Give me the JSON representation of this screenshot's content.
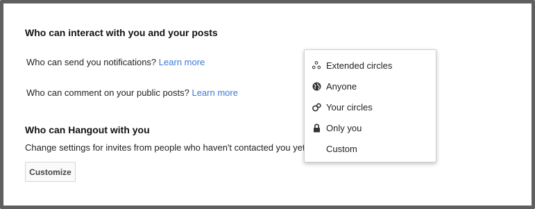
{
  "interact": {
    "title": "Who can interact with you and your posts",
    "notifications": {
      "text": "Who can send you notifications?",
      "link": "Learn more"
    },
    "comments": {
      "text": "Who can comment on your public posts?",
      "link": "Learn more"
    }
  },
  "hangout": {
    "title": "Who can Hangout with you",
    "description": "Change settings for invites from people who haven't contacted you yet.",
    "customize_label": "Customize"
  },
  "dropdown": {
    "items": [
      {
        "label": "Extended circles",
        "icon": "extended-circles-icon"
      },
      {
        "label": "Anyone",
        "icon": "globe-icon"
      },
      {
        "label": "Your circles",
        "icon": "circles-icon"
      },
      {
        "label": "Only you",
        "icon": "lock-icon"
      },
      {
        "label": "Custom",
        "icon": ""
      }
    ]
  },
  "colors": {
    "link": "#3b78d8",
    "frame": "#5f5f5f"
  }
}
